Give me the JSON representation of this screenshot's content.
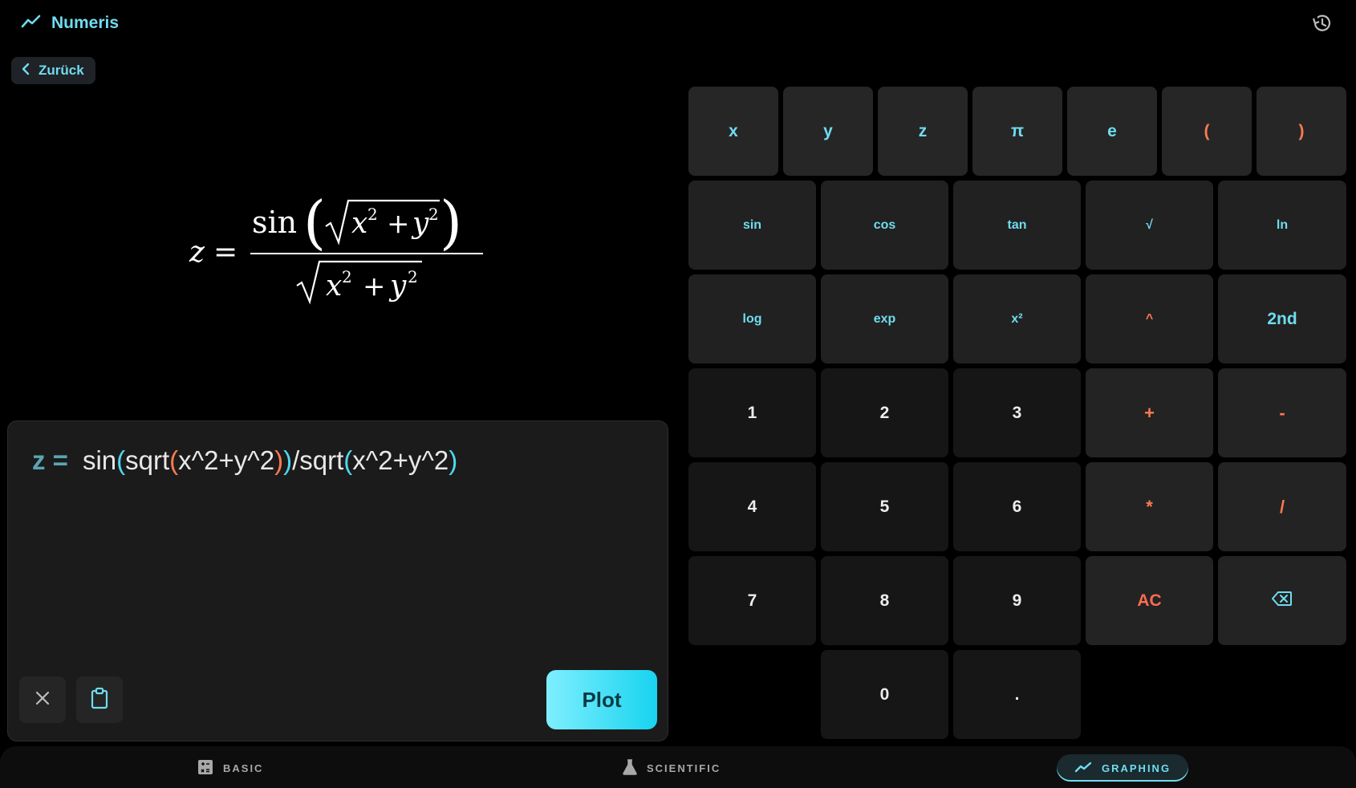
{
  "app": {
    "title": "Numeris",
    "logo_icon": "trending-up-icon",
    "history_icon": "history-icon"
  },
  "back": {
    "label": "Zurück"
  },
  "formula": {
    "lhs": "z",
    "func": "sin",
    "var1": "x",
    "var2": "y",
    "exp": "2"
  },
  "editor": {
    "prefix": "z =",
    "tokens": [
      "sin",
      "(",
      "sqrt",
      "(",
      "x^2+y^2",
      ")",
      ")",
      "/sqrt",
      "(",
      "x^2+y^2",
      ")"
    ],
    "clear_icon": "close-icon",
    "paste_icon": "clipboard-icon",
    "plot_label": "Plot"
  },
  "keypad": {
    "vars": [
      "x",
      "y",
      "z",
      "π",
      "e",
      "(",
      ")"
    ],
    "funcs1": [
      "sin",
      "cos",
      "tan",
      "√",
      "ln"
    ],
    "funcs2": [
      "log",
      "exp",
      "x²",
      "^",
      "2nd"
    ],
    "row1": [
      "1",
      "2",
      "3",
      "+",
      "-"
    ],
    "row2": [
      "4",
      "5",
      "6",
      "*",
      "/"
    ],
    "row3": [
      "7",
      "8",
      "9",
      "AC"
    ],
    "backspace_icon": "backspace-icon",
    "row4": [
      "0",
      "."
    ]
  },
  "nav": [
    {
      "label": "BASIC",
      "icon": "calculator-icon"
    },
    {
      "label": "SCIENTIFIC",
      "icon": "flask-icon"
    },
    {
      "label": "GRAPHING",
      "icon": "trending-up-icon",
      "active": true
    }
  ],
  "colors": {
    "accent": "#6fdcf0",
    "operator": "#ff7a50",
    "background": "#000000"
  }
}
